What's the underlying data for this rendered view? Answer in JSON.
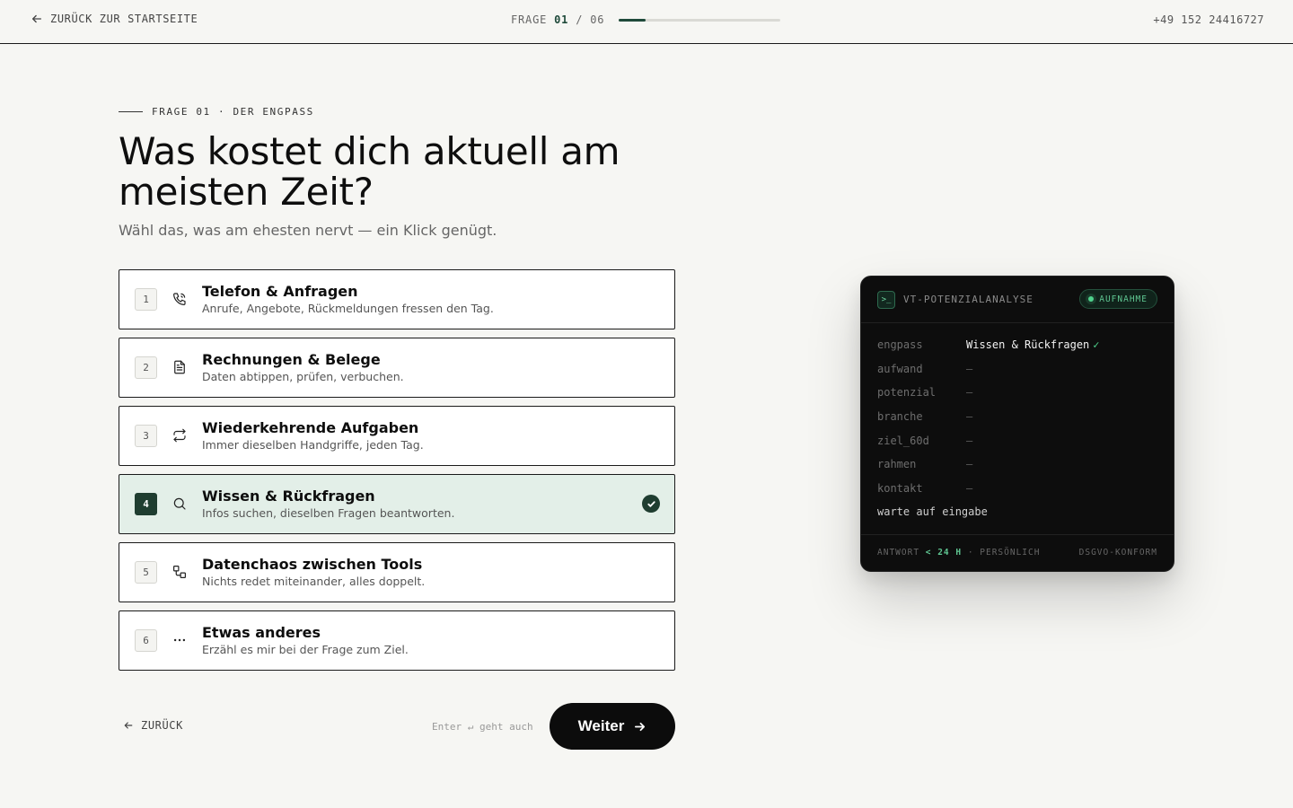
{
  "topbar": {
    "back_label": "ZURÜCK ZUR STARTSEITE",
    "progress_prefix": "FRAGE",
    "progress_current": "01",
    "progress_sep": "/",
    "progress_total": "06",
    "progress_fraction": 0.1667,
    "phone": "+49 152 24416727"
  },
  "question": {
    "eyebrow": "FRAGE 01 · DER ENGPASS",
    "title": "Was kostet dich aktuell am meisten Zeit?",
    "subtitle": "Wähl das, was am ehesten nervt — ein Klick genügt."
  },
  "options": [
    {
      "num": "1",
      "icon": "phone-icon",
      "title": "Telefon & Anfragen",
      "desc": "Anrufe, Angebote, Rückmeldungen fressen den Tag.",
      "selected": false
    },
    {
      "num": "2",
      "icon": "document-icon",
      "title": "Rechnungen & Belege",
      "desc": "Daten abtippen, prüfen, verbuchen.",
      "selected": false
    },
    {
      "num": "3",
      "icon": "repeat-icon",
      "title": "Wiederkehrende Aufgaben",
      "desc": "Immer dieselben Handgriffe, jeden Tag.",
      "selected": false
    },
    {
      "num": "4",
      "icon": "search-icon",
      "title": "Wissen & Rückfragen",
      "desc": "Infos suchen, dieselben Fragen beantworten.",
      "selected": true
    },
    {
      "num": "5",
      "icon": "workflow-icon",
      "title": "Datenchaos zwischen Tools",
      "desc": "Nichts redet miteinander, alles doppelt.",
      "selected": false
    },
    {
      "num": "6",
      "icon": "more-icon",
      "title": "Etwas anderes",
      "desc": "Erzähl es mir bei der Frage zum Ziel.",
      "selected": false
    }
  ],
  "nav": {
    "back_label": "ZURÜCK",
    "hint": "Enter ↵ geht auch",
    "next_label": "Weiter"
  },
  "terminal": {
    "icon_glyph": ">_",
    "title": "VT-POTENZIALANALYSE",
    "badge": "AUFNAHME",
    "rows": [
      {
        "key": "engpass",
        "value": "Wissen & Rückfragen",
        "ok": "✓"
      },
      {
        "key": "aufwand",
        "value": "–"
      },
      {
        "key": "potenzial",
        "value": "–"
      },
      {
        "key": "branche",
        "value": "–"
      },
      {
        "key": "ziel_60d",
        "value": "–"
      },
      {
        "key": "rahmen",
        "value": "–"
      },
      {
        "key": "kontakt",
        "value": "–"
      }
    ],
    "wait": "warte auf eingabe",
    "footer_left_a": "ANTWORT ",
    "footer_left_hl": "< 24 H",
    "footer_left_b": " · PERSÖNLICH",
    "footer_right": "DSGVO-KONFORM"
  },
  "colors": {
    "accent": "#1f3d30",
    "selected_bg": "#e3efe8",
    "status_green": "#4fd28c"
  }
}
